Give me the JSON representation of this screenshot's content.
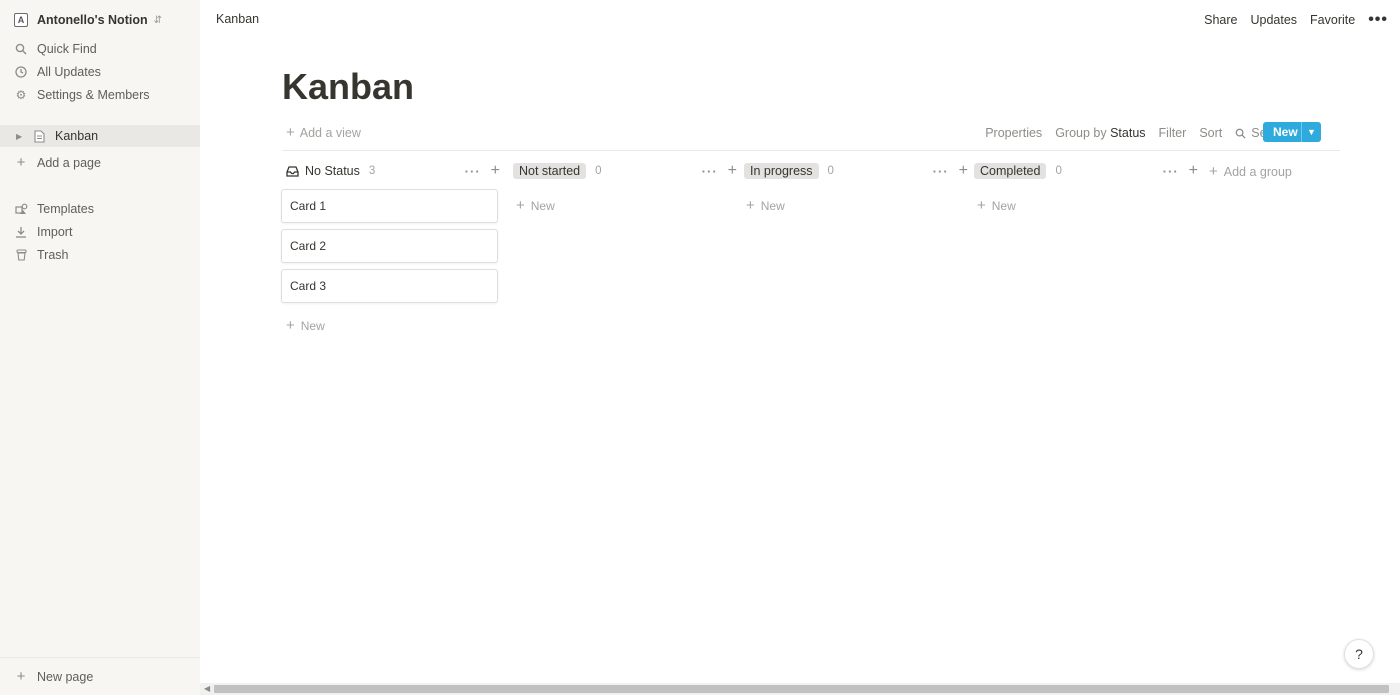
{
  "workspace": {
    "name": "Antonello's Notion",
    "avatar_letter": "A"
  },
  "sidebar": {
    "top_items": [
      {
        "label": "Quick Find",
        "icon": "search-icon"
      },
      {
        "label": "All Updates",
        "icon": "clock-icon"
      },
      {
        "label": "Settings & Members",
        "icon": "gear-icon"
      }
    ],
    "pages": [
      {
        "label": "Kanban",
        "icon": "page-icon"
      }
    ],
    "add_page": "Add a page",
    "bottom_items": [
      {
        "label": "Templates",
        "icon": "templates-icon"
      },
      {
        "label": "Import",
        "icon": "import-icon"
      },
      {
        "label": "Trash",
        "icon": "trash-icon"
      }
    ],
    "new_page": "New page"
  },
  "topbar": {
    "breadcrumb": "Kanban",
    "actions": {
      "share": "Share",
      "updates": "Updates",
      "favorite": "Favorite"
    }
  },
  "page": {
    "title": "Kanban",
    "add_view": "Add a view",
    "toolbar": {
      "properties": "Properties",
      "group_by": "Group by",
      "group_by_value": "Status",
      "filter": "Filter",
      "sort": "Sort",
      "search": "Search",
      "new_button": "New"
    }
  },
  "board": {
    "columns": [
      {
        "name": "No Status",
        "count": "3",
        "cards": [
          "Card 1",
          "Card 2",
          "Card 3"
        ],
        "new_label": "New"
      },
      {
        "name": "Not started",
        "count": "0",
        "cards": [],
        "new_label": "New"
      },
      {
        "name": "In progress",
        "count": "0",
        "cards": [],
        "new_label": "New"
      },
      {
        "name": "Completed",
        "count": "0",
        "cards": [],
        "new_label": "New"
      }
    ],
    "add_group": "Add a group"
  },
  "help_label": "?",
  "colors": {
    "accent": "#2eaadc",
    "sidebar_bg": "#f7f6f3",
    "pill_bg": "#e3e2e0"
  }
}
